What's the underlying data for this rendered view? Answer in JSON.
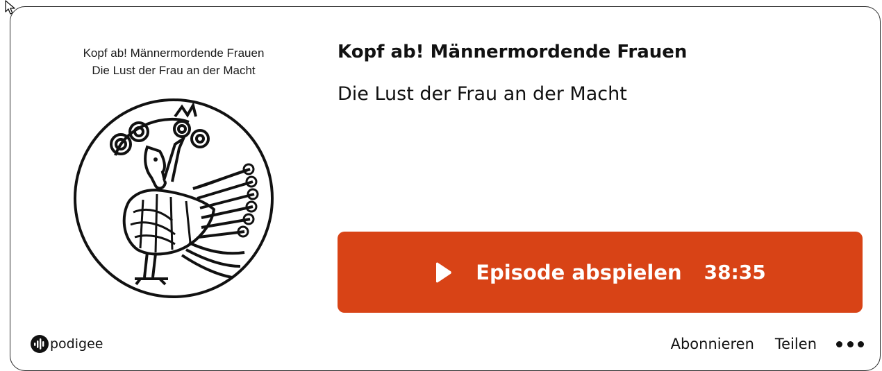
{
  "colors": {
    "accent": "#d84316",
    "text": "#111111",
    "border": "#2a2a2a"
  },
  "cover": {
    "line1": "Kopf ab!  Männermordende Frauen",
    "line2": "Die Lust der Frau an der Macht",
    "art_icon": "harpy-illustration-icon"
  },
  "episode": {
    "title": "Kopf ab! Männermordende Frauen",
    "subtitle": "Die Lust der Frau an der Macht"
  },
  "player": {
    "play_label": "Episode abspielen",
    "duration": "38:35",
    "play_icon": "play-icon"
  },
  "branding": {
    "name": "podigee",
    "icon": "podigee-logo-icon"
  },
  "actions": {
    "subscribe": "Abonnieren",
    "share": "Teilen",
    "more_icon": "more-dots-icon"
  }
}
